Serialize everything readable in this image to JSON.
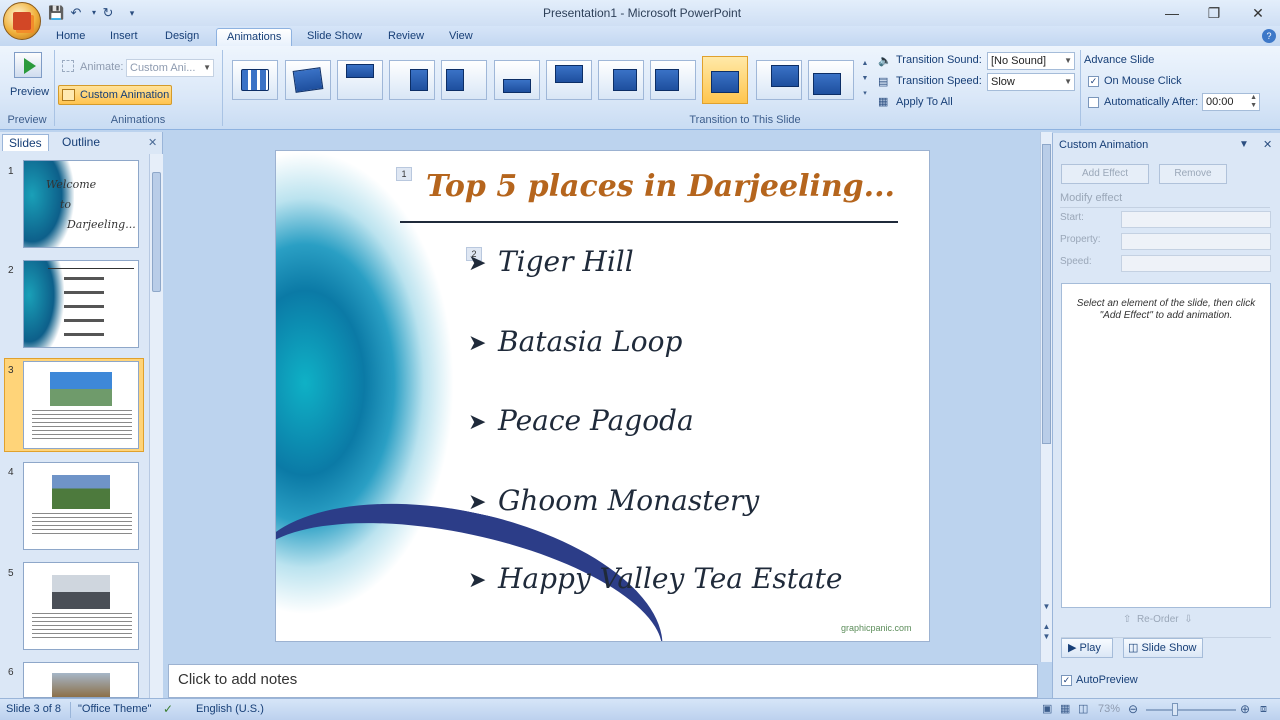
{
  "window": {
    "title": "Presentation1 - Microsoft PowerPoint"
  },
  "tabs": [
    "Home",
    "Insert",
    "Design",
    "Animations",
    "Slide Show",
    "Review",
    "View"
  ],
  "active_tab": "Animations",
  "ribbon": {
    "preview_label": "Preview",
    "preview_group": "Preview",
    "animate_label": "Animate:",
    "animate_value": "Custom Ani...",
    "custom_animation_label": "Custom Animation",
    "animations_group": "Animations",
    "transition_group": "Transition to This Slide",
    "transition_sound_label": "Transition Sound:",
    "transition_sound_value": "[No Sound]",
    "transition_speed_label": "Transition Speed:",
    "transition_speed_value": "Slow",
    "apply_to_all_label": "Apply To All",
    "advance_slide_label": "Advance Slide",
    "on_mouse_click_label": "On Mouse Click",
    "on_mouse_click_checked": true,
    "automatically_after_label": "Automatically After:",
    "automatically_after_value": "00:00",
    "automatically_after_checked": false
  },
  "left_pane": {
    "tab_slides": "Slides",
    "tab_outline": "Outline",
    "slide_numbers": [
      "1",
      "2",
      "3",
      "4",
      "5",
      "6"
    ],
    "selected_slide": 3
  },
  "slide": {
    "title": "Top 5 places in Darjeeling...",
    "title_color": "#b5651d",
    "anim_tag_1": "1",
    "anim_tag_2": "2",
    "bullets": [
      "Tiger Hill",
      "Batasia Loop",
      "Peace Pagoda",
      "Ghoom Monastery",
      "Happy Valley Tea Estate"
    ],
    "watermark": "graphicpanic.com"
  },
  "notes": {
    "placeholder": "Click to add notes"
  },
  "right_pane": {
    "title": "Custom Animation",
    "add_effect": "Add Effect",
    "remove": "Remove",
    "modify_effect": "Modify effect",
    "start_label": "Start:",
    "property_label": "Property:",
    "speed_label": "Speed:",
    "hint": "Select an element of the slide, then click \"Add Effect\" to add animation.",
    "reorder": "Re-Order",
    "play": "Play",
    "slide_show": "Slide Show",
    "autopreview": "AutoPreview",
    "autopreview_checked": true
  },
  "status": {
    "slide_info": "Slide 3 of 8",
    "theme": "\"Office Theme\"",
    "language": "English (U.S.)",
    "zoom": "73%"
  }
}
